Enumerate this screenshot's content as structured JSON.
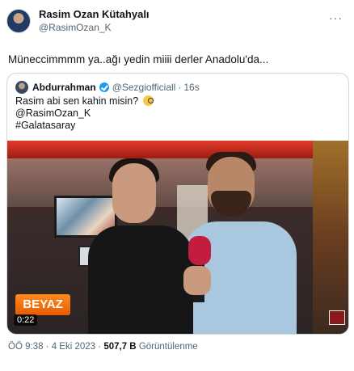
{
  "author": {
    "name": "Rasim Ozan Kütahyalı",
    "handle": "@RasimOzan_K",
    "avatar_icon": "profile-avatar"
  },
  "tweet": {
    "text": "Müneccimmmm ya..ağı yedin miiii derler Anadolu'da..."
  },
  "quoted": {
    "name": "Abdurrahman",
    "handle": "@Sezgiofficiall",
    "separator": "·",
    "time": "16s",
    "lines": [
      "Rasim abi sen kahin misin?",
      "@RasimOzan_K",
      "#Galatasaray"
    ],
    "video": {
      "logo_text": "BEYAZ",
      "duration": "0:22"
    }
  },
  "meta": {
    "time": "ÖÖ 9:38",
    "dot": "·",
    "date": "4 Eki 2023",
    "views_count": "507,7 B",
    "views_label": "Görüntülenme"
  },
  "colors": {
    "verified": "#1d9bf0",
    "text_primary": "#0f1419",
    "text_secondary": "#536471",
    "border": "#cfd9de"
  }
}
